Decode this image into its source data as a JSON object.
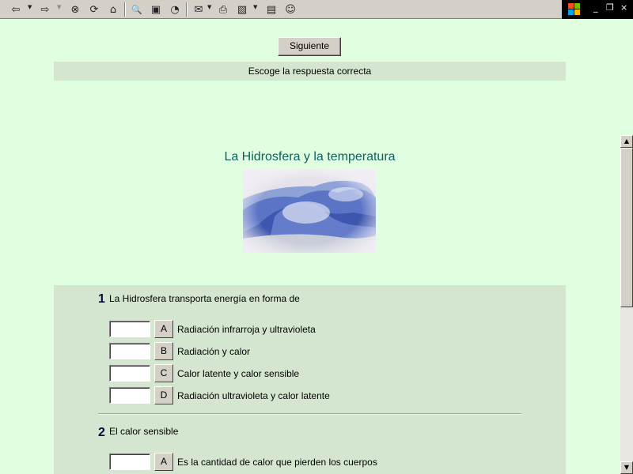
{
  "toolbar": {
    "buttons": [
      {
        "name": "back-icon",
        "glyph": "⇦"
      },
      {
        "name": "forward-icon",
        "glyph": "⇨"
      },
      {
        "name": "stop-icon",
        "glyph": "⊗"
      },
      {
        "name": "refresh-icon",
        "glyph": "⟳"
      },
      {
        "name": "home-icon",
        "glyph": "⌂"
      },
      {
        "name": "search-icon",
        "glyph": "🔍"
      },
      {
        "name": "favorites-icon",
        "glyph": "▣"
      },
      {
        "name": "history-icon",
        "glyph": "◔"
      },
      {
        "name": "mail-icon",
        "glyph": "✉"
      },
      {
        "name": "print-icon",
        "glyph": "⎙"
      },
      {
        "name": "edit-icon",
        "glyph": "▧"
      },
      {
        "name": "discuss-icon",
        "glyph": "▤"
      },
      {
        "name": "messenger-icon",
        "glyph": "☺"
      }
    ],
    "window_controls": {
      "minimize": "_",
      "restore": "❐",
      "close": "×"
    }
  },
  "page": {
    "next_button_label": "Siguiente",
    "instruction": "Escoge la respuesta correcta",
    "title": "La Hidrosfera y la temperatura"
  },
  "questions": [
    {
      "number": "1",
      "text": "La Hidrosfera transporta energía en forma de",
      "options": [
        {
          "letter": "A",
          "text": "Radiación infrarroja y ultravioleta",
          "value": ""
        },
        {
          "letter": "B",
          "text": "Radiación y calor",
          "value": ""
        },
        {
          "letter": "C",
          "text": "Calor latente y calor sensible",
          "value": ""
        },
        {
          "letter": "D",
          "text": "Radiación ultravioleta y calor latente",
          "value": ""
        }
      ]
    },
    {
      "number": "2",
      "text": "El calor sensible",
      "options": [
        {
          "letter": "A",
          "text": "Es la cantidad de calor que pierden los cuerpos",
          "value": ""
        }
      ]
    }
  ],
  "colors": {
    "background": "#e0ffe0",
    "panel": "#d4e6d0",
    "title": "#0d6060"
  }
}
